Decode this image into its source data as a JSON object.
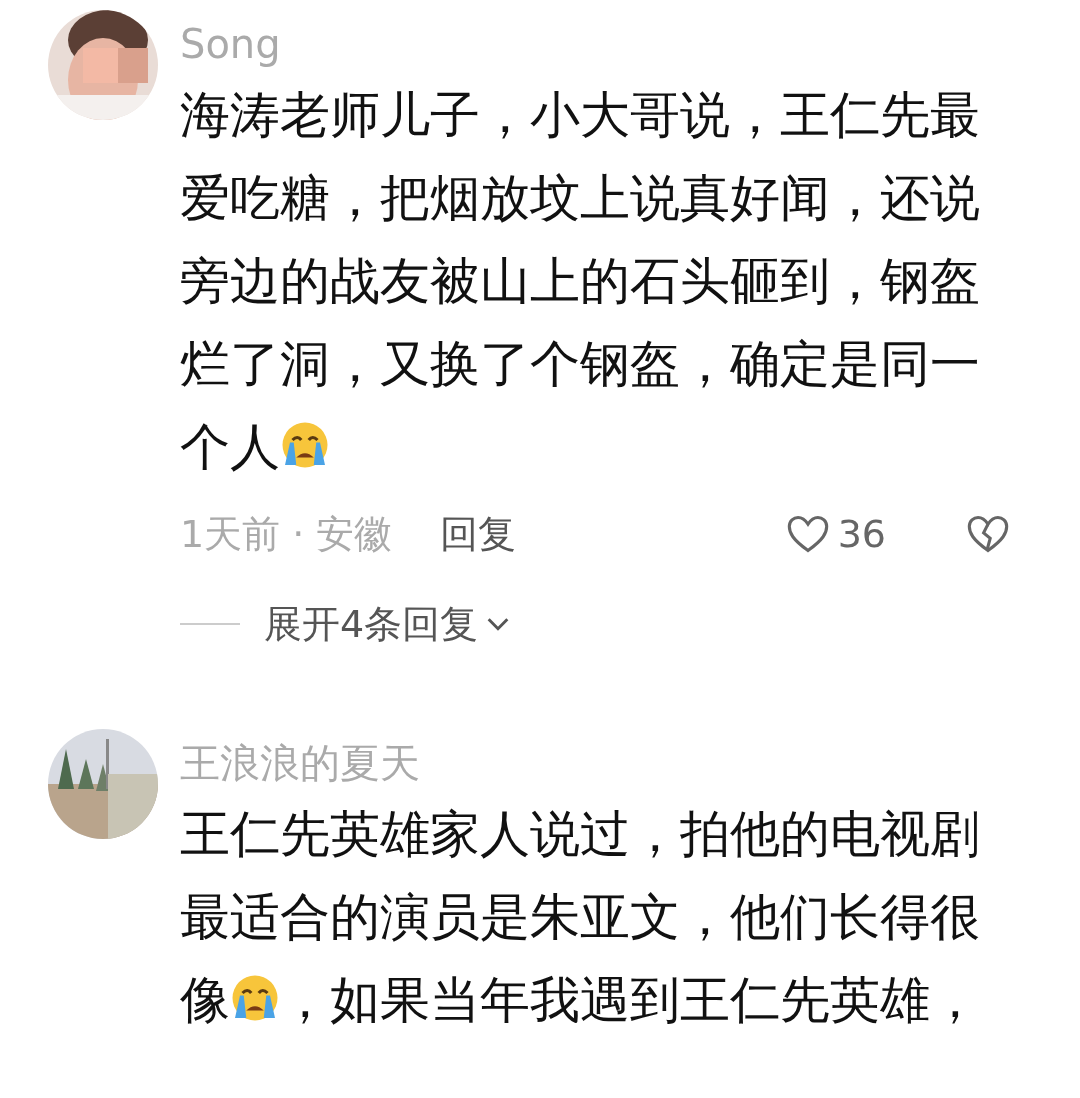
{
  "comments": [
    {
      "author": "Song",
      "avatar": {
        "kind": "picture"
      },
      "parts": [
        {
          "kind": "text",
          "text": "海涛老师儿子，小大哥说，王仁先最爱吃糖，把烟放坟上说真好闻，还说旁边的战友被山上的石头砸到，钢盔烂了洞，又换了个钢盔，确定是同一个人"
        },
        {
          "kind": "emoji"
        }
      ],
      "time": "1天前 · 安徽",
      "reply": "回复",
      "likes": "36",
      "expand": "展开4条回复"
    },
    {
      "author": "王浪浪的夏天",
      "avatar": {
        "kind": "picture"
      },
      "parts": [
        {
          "kind": "text",
          "text": "王仁先英雄家人说过，拍他的电视剧最适合的演员是朱亚文，他们长得很像"
        },
        {
          "kind": "emoji"
        },
        {
          "kind": "text",
          "text": "，如果当年我遇到王仁先英雄，"
        }
      ]
    }
  ]
}
